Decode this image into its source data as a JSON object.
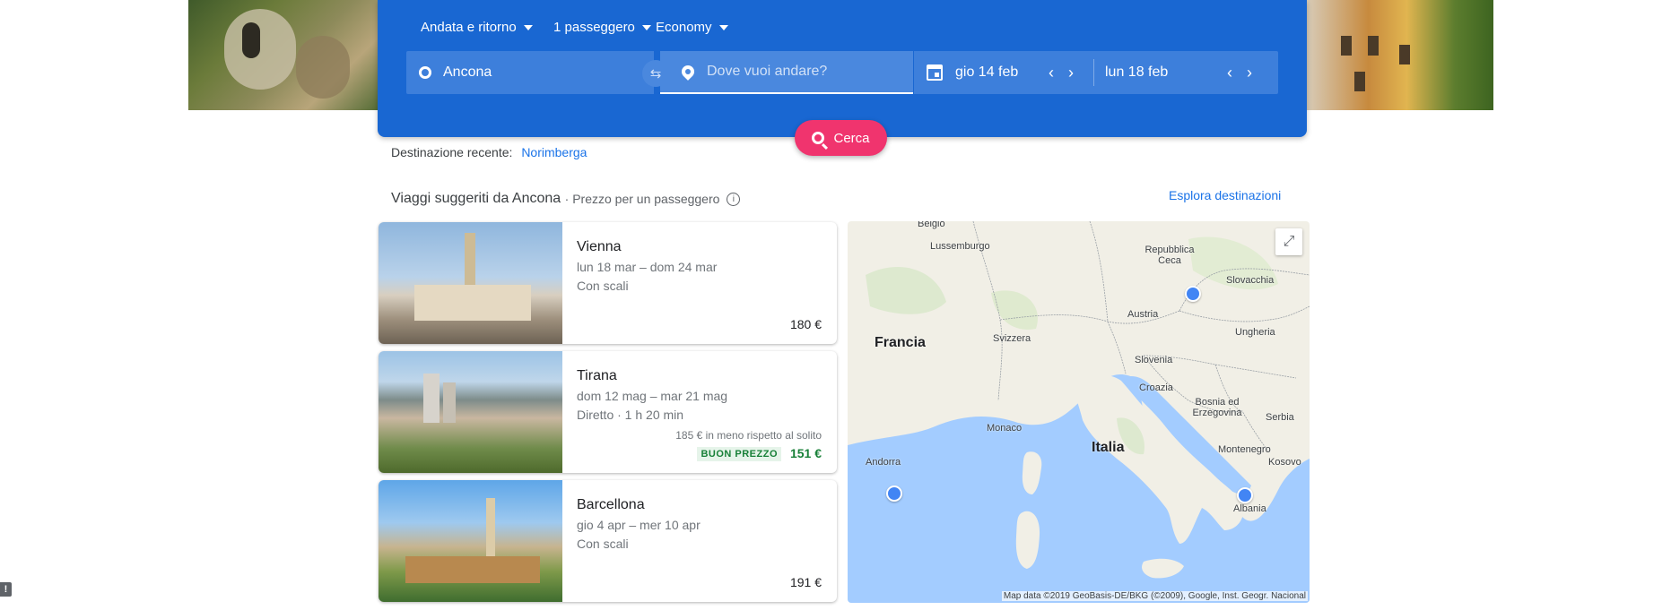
{
  "search": {
    "trip_type": "Andata e ritorno",
    "passengers": "1 passeggero",
    "cabin_class": "Economy",
    "origin": "Ancona",
    "destination_placeholder": "Dove vuoi andare?",
    "depart_date": "gio 14 feb",
    "return_date": "lun 18 feb",
    "search_button": "Cerca",
    "swap_icon": "swap-icon",
    "date_icon": "calendar-icon"
  },
  "recent": {
    "label": "Destinazione recente:",
    "link": "Norimberga"
  },
  "suggested": {
    "title": "Viaggi suggeriti da Ancona",
    "subtitle": "· Prezzo per un passeggero",
    "explore_link": "Esplora destinazioni"
  },
  "trips": [
    {
      "city": "Vienna",
      "dates": "lun 18 mar – dom 24 mar",
      "stops": "Con scali",
      "price": "180 €"
    },
    {
      "city": "Tirana",
      "dates": "dom 12 mag – mar 21 mag",
      "stops": "Diretto · 1 h 20 min",
      "saving": "185 € in meno rispetto al solito",
      "badge": "BUON PREZZO",
      "price": "151 €"
    },
    {
      "city": "Barcellona",
      "dates": "gio 4 apr – mer 10 apr",
      "stops": "Con scali",
      "price": "191 €"
    }
  ],
  "map": {
    "labels": {
      "belgio": "Belgio",
      "lussemburgo": "Lussemburgo",
      "francia": "Francia",
      "svizzera": "Svizzera",
      "austria": "Austria",
      "repubblica_ceca": "Repubblica Ceca",
      "slovacchia": "Slovacchia",
      "ungheria": "Ungheria",
      "slovenia": "Slovenia",
      "croazia": "Croazia",
      "bosnia": "Bosnia ed Erzegovina",
      "serbia": "Serbia",
      "monaco": "Monaco",
      "italia": "Italia",
      "andorra": "Andorra",
      "montenegro": "Montenegro",
      "kosovo": "Kosovo",
      "albania": "Albania"
    },
    "attribution": "Map data ©2019 GeoBasis-DE/BKG (©2009), Google, Inst. Geogr. Nacional",
    "water_color": "#a3ccff",
    "land_color": "#f1efe6",
    "marker_color": "#4285f4"
  },
  "colors": {
    "primary": "#1967d2",
    "accent": "#f0346e",
    "link": "#1a73e8",
    "good_price": "#188038"
  }
}
